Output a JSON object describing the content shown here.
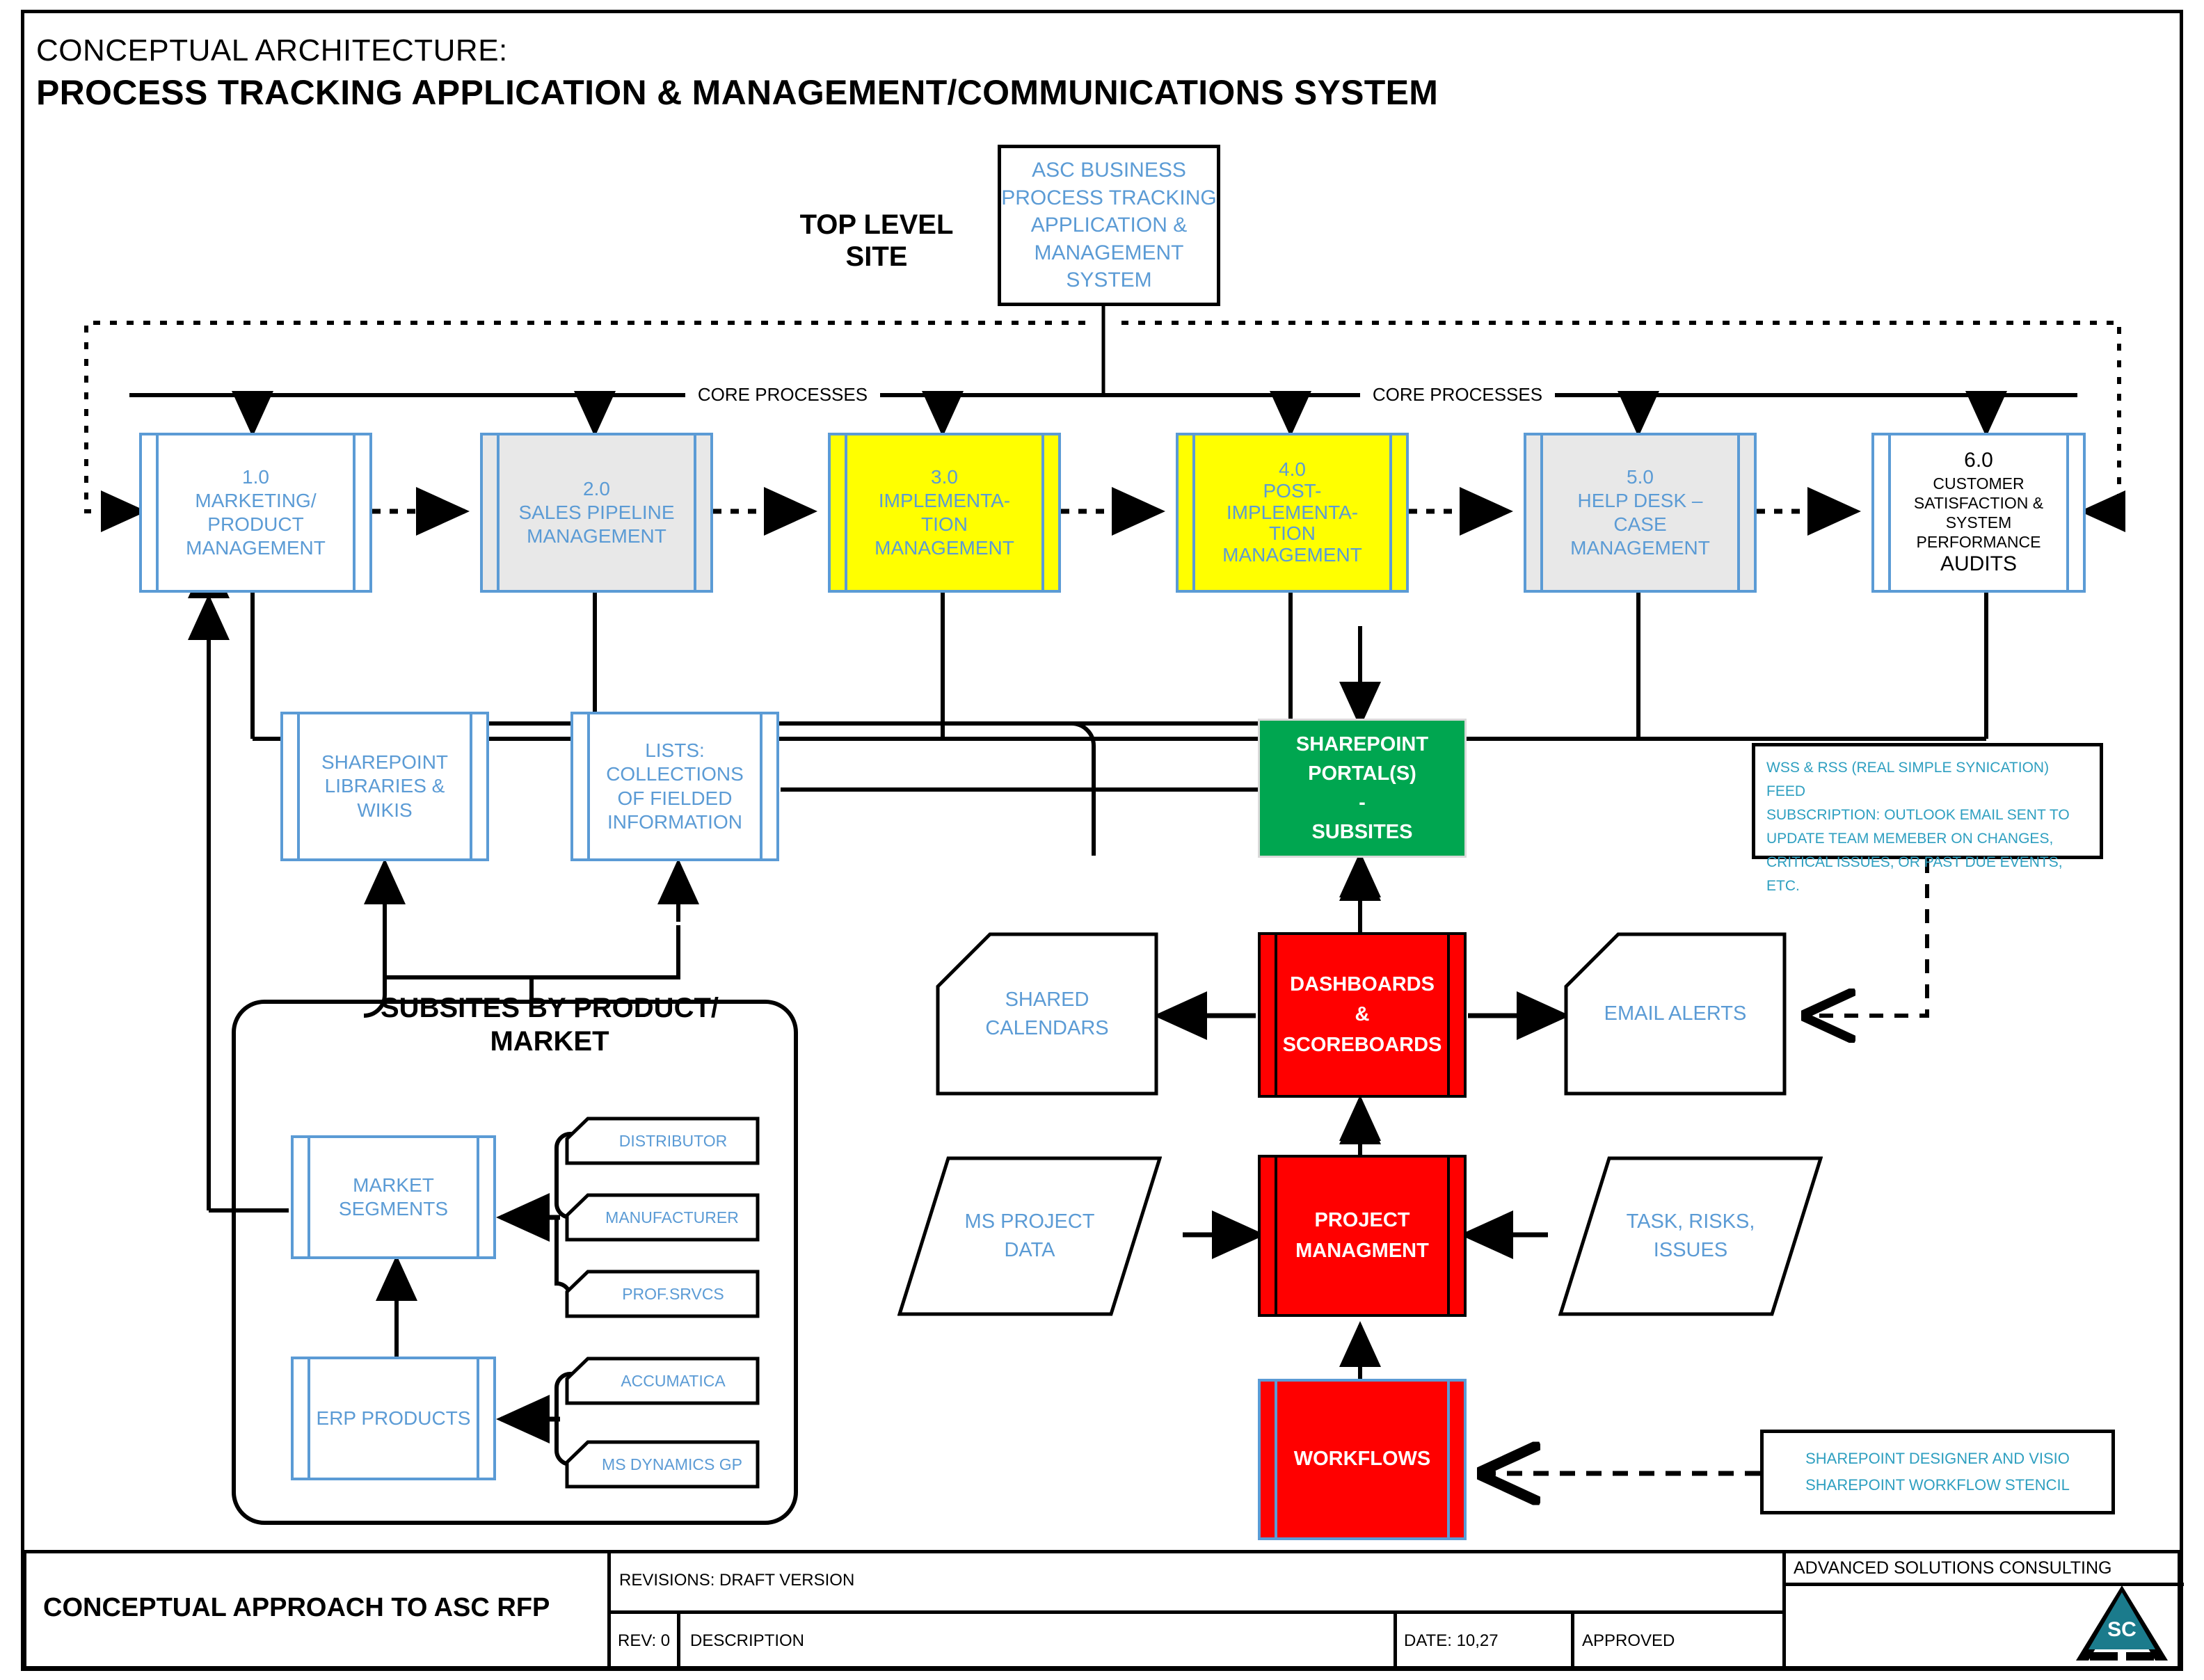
{
  "document": {
    "title_line1": "CONCEPTUAL ARCHITECTURE:",
    "title_line2": "PROCESS TRACKING APPLICATION & MANAGEMENT/COMMUNICATIONS SYSTEM"
  },
  "labels": {
    "top_level_site": "TOP LEVEL\nSITE",
    "core_processes_left": "CORE PROCESSES",
    "core_processes_right": "CORE PROCESSES",
    "subsites_by_product": "SUBSITES BY PRODUCT/\nMARKET"
  },
  "top_node": {
    "text": "ASC BUSINESS PROCESS TRACKING APPLICATION & MANAGEMENT SYSTEM",
    "lines": [
      "ASC BUSINESS",
      "PROCESS TRACKING",
      "APPLICATION &",
      "MANAGEMENT",
      "SYSTEM"
    ]
  },
  "core_processes": [
    {
      "id": "1.0",
      "number": "1.0",
      "lines": [
        "MARKETING/",
        "PRODUCT",
        "MANAGEMENT"
      ],
      "fill": "#ffffff",
      "text_color": "#5b9bd5"
    },
    {
      "id": "2.0",
      "number": "2.0",
      "lines": [
        "SALES PIPELINE",
        "MANAGEMENT"
      ],
      "fill": "#e8e8e8",
      "text_color": "#5b9bd5"
    },
    {
      "id": "3.0",
      "number": "3.0",
      "lines": [
        "IMPLEMENTA-",
        "TION",
        "MANAGEMENT"
      ],
      "fill": "#ffff00",
      "text_color": "#5b9bd5"
    },
    {
      "id": "4.0",
      "number": "4.0",
      "lines": [
        "POST-",
        "IMPLEMENTA-",
        "TION",
        "MANAGEMENT"
      ],
      "fill": "#ffff00",
      "text_color": "#5b9bd5"
    },
    {
      "id": "5.0",
      "number": "5.0",
      "lines": [
        "HELP DESK –",
        "CASE",
        "MANAGEMENT"
      ],
      "fill": "#e8e8e8",
      "text_color": "#5b9bd5"
    },
    {
      "id": "6.0",
      "number": "6.0",
      "lines": [
        "CUSTOMER",
        "SATISFACTION &",
        "SYSTEM",
        "PERFORMANCE",
        "AUDITS"
      ],
      "fill": "#ffffff",
      "text_color": "#000000"
    }
  ],
  "content_nodes": {
    "sharepoint_libraries": [
      "SHAREPOINT",
      "LIBRARIES &",
      "WIKIS"
    ],
    "lists": [
      "LISTS:",
      "COLLECTIONS",
      "OF FIELDED",
      "INFORMATION"
    ],
    "sharepoint_portal": [
      "SHAREPOINT",
      "PORTAL(S)",
      "-",
      "SUBSITES"
    ],
    "market_segments": [
      "MARKET",
      "SEGMENTS"
    ],
    "erp_products": [
      "ERP PRODUCTS"
    ]
  },
  "market_segment_items": [
    "DISTRIBUTOR",
    "MANUFACTURER",
    "PROF.SRVCS"
  ],
  "erp_product_items": [
    "ACCUMATICA",
    "MS DYNAMICS GP"
  ],
  "right_cluster": {
    "shared_calendars": [
      "SHARED",
      "CALENDARS"
    ],
    "dashboards": [
      "DASHBOARDS",
      "&",
      "SCOREBOARDS"
    ],
    "email_alerts": [
      "EMAIL ALERTS"
    ],
    "ms_project_data": [
      "MS PROJECT",
      "DATA"
    ],
    "project_management": [
      "PROJECT",
      "MANAGMENT"
    ],
    "task_risks_issues": [
      "TASK, RISKS,",
      "ISSUES"
    ],
    "workflows": [
      "WORKFLOWS"
    ]
  },
  "notes": {
    "wss_rss": [
      "WSS & RSS (REAL SIMPLE SYNICATION) FEED",
      "SUBSCRIPTION: OUTLOOK EMAIL SENT TO",
      "UPDATE TEAM MEMEBER ON CHANGES,",
      "CRITICAL ISSUES, OR PAST DUE EVENTS, ETC."
    ],
    "designer_stencil": [
      "SHAREPOINT DESIGNER AND VISIO",
      "SHAREPOINT WORKFLOW STENCIL"
    ]
  },
  "title_block": {
    "drawing_title": "CONCEPTUAL APPROACH TO ASC RFP",
    "revisions": "REVISIONS: DRAFT VERSION",
    "rev": "REV: 0",
    "description": "DESCRIPTION",
    "date": "DATE: 10,27",
    "approved": "APPROVED",
    "company": "ADVANCED SOLUTIONS CONSULTING",
    "logo_text": "SC"
  },
  "colors": {
    "accent_blue": "#5b9bd5",
    "green": "#00a650",
    "red": "#ff0000",
    "yellow": "#ffff00",
    "grey": "#e8e8e8",
    "logo_teal": "#1b7b8c"
  }
}
